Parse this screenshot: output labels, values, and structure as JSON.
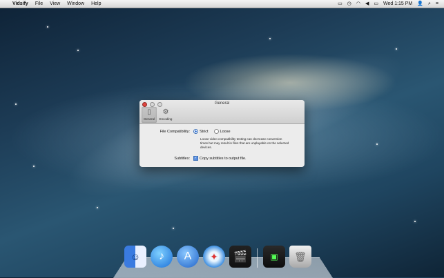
{
  "menubar": {
    "apple": "",
    "app_name": "Vidsify",
    "items": [
      "File",
      "View",
      "Window",
      "Help"
    ],
    "clock": "Wed 1:15 PM"
  },
  "window": {
    "title": "General",
    "toolbar": [
      {
        "label": "General",
        "icon": "general-prefs-icon",
        "selected": true
      },
      {
        "label": "Encoding",
        "icon": "gear-icon",
        "selected": false
      }
    ],
    "file_compat": {
      "label": "File Compatibility:",
      "options": [
        "Strict",
        "Loose"
      ],
      "selected": "Strict",
      "note": "Loose video compatibility testing can decrease conversion times but may result in files that are unplayable on the selected devices."
    },
    "subtitles": {
      "label": "Subtitles:",
      "checkbox_label": "Copy subtitles to output file.",
      "checked": true
    }
  },
  "dock": {
    "items": [
      "finder-icon",
      "itunes-icon",
      "app-store-icon",
      "safari-icon",
      "video-clapper-icon",
      "vidsify-icon",
      "trash-icon"
    ]
  }
}
